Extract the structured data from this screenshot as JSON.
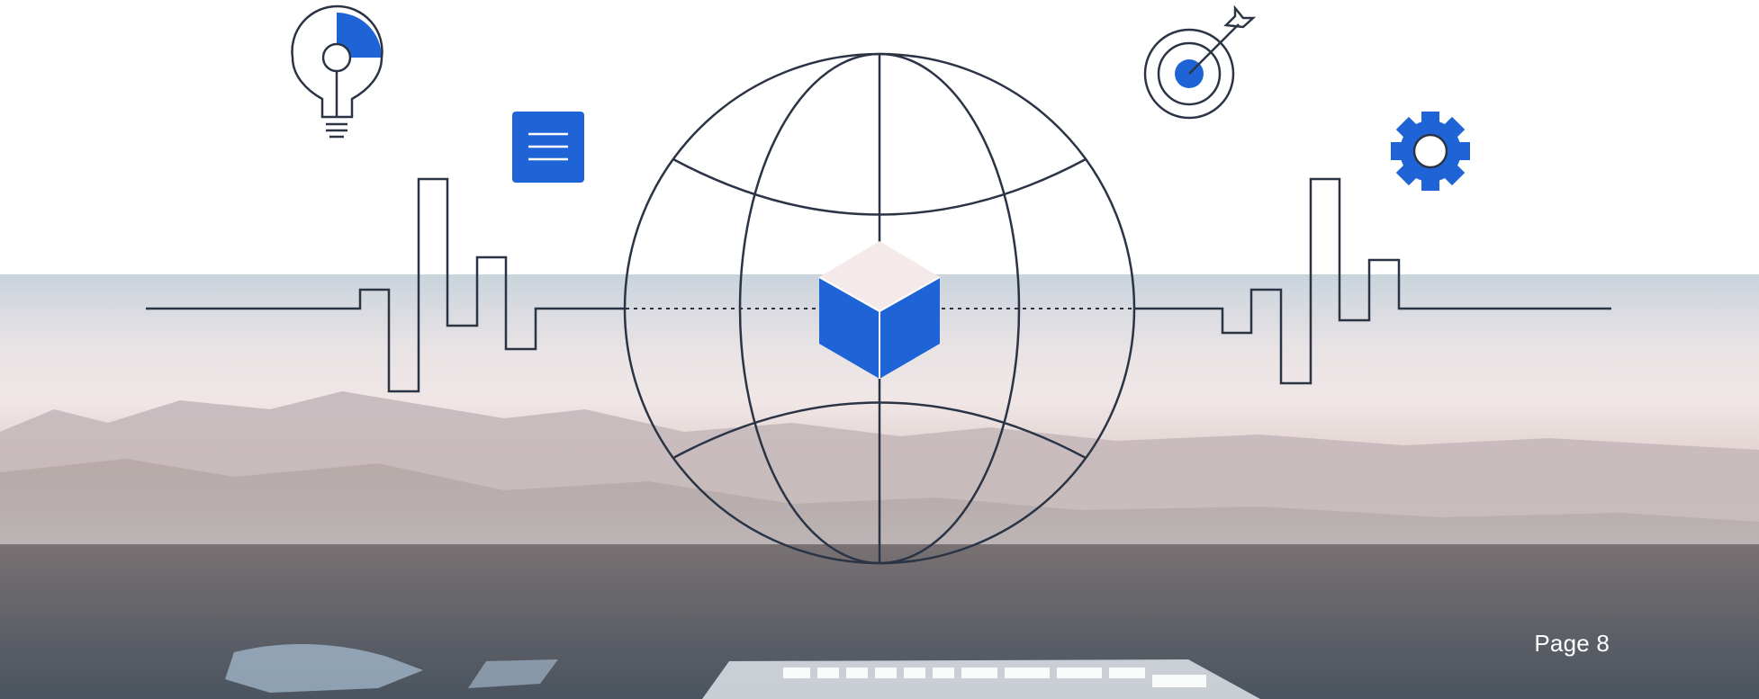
{
  "colors": {
    "accent": "#1e64d6",
    "line": "#2b3445",
    "cube_top": "#f5eaea"
  },
  "icons": {
    "lightbulb": "lightbulb-icon",
    "document": "document-lines-icon",
    "target": "target-arrow-icon",
    "gear": "gear-icon",
    "globe": "globe-icon",
    "cube": "cube-icon"
  },
  "footer": {
    "page_label": "Page 8"
  }
}
